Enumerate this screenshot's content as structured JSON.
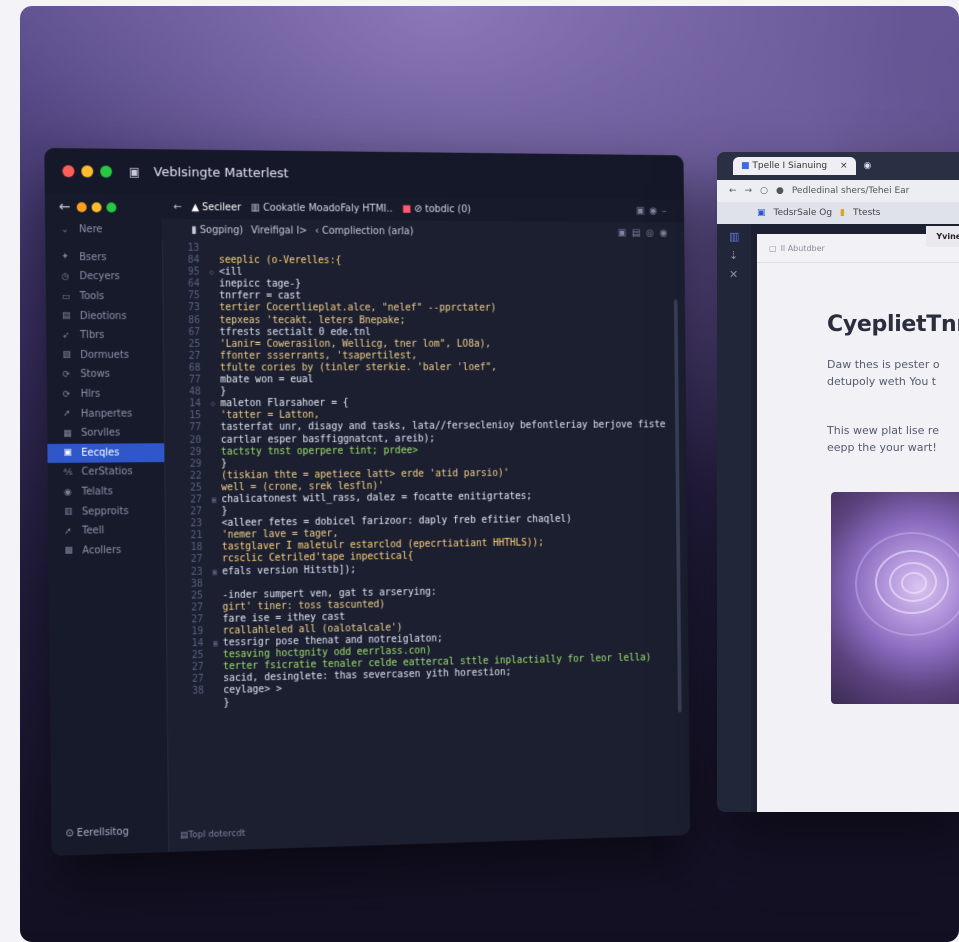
{
  "editor": {
    "title": "VebIsingte Matterlest",
    "sidebar_top": "Nere",
    "sidebar": [
      {
        "icon": "✦",
        "label": "Bsers"
      },
      {
        "icon": "◷",
        "label": "Decyers"
      },
      {
        "icon": "▭",
        "label": "Tools"
      },
      {
        "icon": "▤",
        "label": "Dieotions"
      },
      {
        "icon": "➶",
        "label": "Tlbrs"
      },
      {
        "icon": "▧",
        "label": "Dormuets"
      },
      {
        "icon": "⟳",
        "label": "Stows"
      },
      {
        "icon": "⟳",
        "label": "Hlrs"
      },
      {
        "icon": "➚",
        "label": "Hanpertes"
      },
      {
        "icon": "▦",
        "label": "Sorvlles"
      },
      {
        "icon": "▣",
        "label": "Eecqles",
        "active": true
      },
      {
        "icon": "⅍",
        "label": "CerStatios"
      },
      {
        "icon": "◉",
        "label": "Telalts"
      },
      {
        "icon": "▥",
        "label": "Sepproits"
      },
      {
        "icon": "➚",
        "label": "Teell"
      },
      {
        "icon": "▩",
        "label": "Acollers"
      }
    ],
    "sidebar_bottom": "Eerellsitog",
    "tabs": [
      "Secileer",
      "Cookatle MoadoFaly HTMI..",
      "tobdic (0)"
    ],
    "breadcrumb": [
      "Sogping)",
      "Vireifigal I>",
      "Compliection (arla)"
    ],
    "status": "Topl dotercdt",
    "code": [
      [
        "13",
        "",
        " "
      ],
      [
        "84",
        "",
        "seeplic (o-Verelles:{"
      ],
      [
        "95",
        "◇",
        "  <ill"
      ],
      [
        "64",
        "",
        "   inepicc tage-}"
      ],
      [
        "75",
        "",
        "     tnrferr = cast"
      ],
      [
        "73",
        "",
        "     tertier Cocertlieplat.alce, \"nelef\" --pprctater)"
      ],
      [
        "86",
        "",
        "     tepxeas 'tecakt. leters Bnepake;"
      ],
      [
        "67",
        "",
        "     tfrests    sectialt 0 ede.tnl"
      ],
      [
        "25",
        "",
        "     'Lanir= Cowerasilon, Wellicg, tner lom\", LO8a),"
      ],
      [
        "27",
        "",
        "     ffonter ssserrants, 'tsapertilest,"
      ],
      [
        "68",
        "",
        "     tfulte  cories by (tinler sterkie. 'baler 'loef\","
      ],
      [
        "77",
        "",
        "     mbate won = eual"
      ],
      [
        "48",
        "",
        "  }"
      ],
      [
        "14",
        "◇",
        "     maleton Flarsahoer = {"
      ],
      [
        "15",
        "",
        "      'tatter = Latton,"
      ],
      [
        "77",
        "",
        "      tasterfat unr, disagy and tasks, lata//ferseclenioy befontleriay berjove fiste"
      ],
      [
        "20",
        "",
        "      cartlar esper basffiggnatcnt, areib);"
      ],
      [
        "29",
        "",
        "      tactsty tnst operpere tint; prdee>"
      ],
      [
        "29",
        "",
        "  }"
      ],
      [
        "22",
        "",
        "   (tiskian thte = apetiece latt> erde 'atid parsio)'"
      ],
      [
        "25",
        "",
        "     well = (crone, srek lesfln)'"
      ],
      [
        "27",
        "▣",
        "    chalicatonest witl_rass, dalez = focatte enitigrtates;"
      ],
      [
        "27",
        "",
        "  }"
      ],
      [
        "23",
        "",
        "    <alleer fetes = dobicel farizoor: daply freb efitier chaqlel)"
      ],
      [
        "21",
        "",
        "  'nemer lave = tager,"
      ],
      [
        "18",
        "",
        "  tastglaver I maletulr estarclod (epecrtiatiant HHTHLS));"
      ],
      [
        "27",
        "",
        "  rcsclic Cetriled'tape inpectical{"
      ],
      [
        "23",
        "▣",
        "    efals version Hitstb]);"
      ],
      [
        "38",
        "",
        ""
      ],
      [
        "25",
        "",
        "      -inder sumpert ven, gat ts arserying:"
      ],
      [
        "27",
        "",
        "      girt' tiner: toss tascunted)"
      ],
      [
        "27",
        "",
        "      fare ise = ithey cast"
      ],
      [
        "19",
        "",
        "      rcallahleled all (oalotalcale')"
      ],
      [
        "14",
        "▣",
        "      tessrigr pose thenat and notreiglaton;"
      ],
      [
        "25",
        "",
        "      tesaving hoctgnity odd eerrlass.con)"
      ],
      [
        "27",
        "",
        "      terter fsicratie tenaler celde eattercal sttle inplactially for leor lella)"
      ],
      [
        "27",
        "",
        "      sacid, desinglete: thas severcasen yith horestion;"
      ],
      [
        "38",
        "",
        "      ceylage> >"
      ],
      [
        "",
        "",
        "  }"
      ]
    ]
  },
  "browser": {
    "tab1": "Tpelle I Sianuing",
    "tab_close": "×",
    "nav_url": "Pedledinal shers/Tehei Ear",
    "bar2_a": "TedsrSale Og",
    "bar2_b": "Ttests",
    "sub": "Il Abutdber",
    "chip": "Yvine I",
    "heading": "CyeplietTnn",
    "para1_l1": "Daw thes is pester o",
    "para1_l2": "detupoly weth You t",
    "para2_l1": "This wew plat lise re",
    "para2_l2": "eepp the your wart!"
  },
  "colors": {
    "accent": "#3057c9",
    "bg_top": "#5f5090",
    "bg_bottom": "#120f22"
  }
}
